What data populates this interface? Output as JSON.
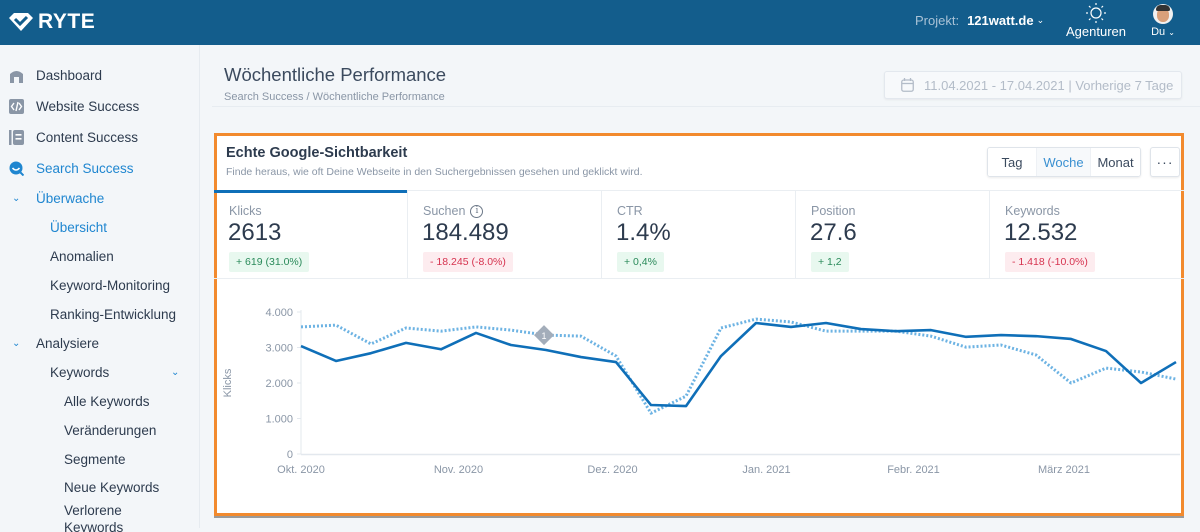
{
  "header": {
    "logo_text": "RYTE",
    "project_label": "Projekt:",
    "project_value": "121watt.de",
    "agencies_label": "Agenturen",
    "user_label": "Du"
  },
  "sidebar": {
    "items": [
      {
        "label": "Dashboard",
        "icon": "home-icon",
        "level": 0
      },
      {
        "label": "Website Success",
        "icon": "code-icon",
        "level": 0
      },
      {
        "label": "Content Success",
        "icon": "document-icon",
        "level": 0
      },
      {
        "label": "Search Success",
        "icon": "search-icon",
        "level": 0,
        "active": true
      },
      {
        "label": "Überwache",
        "level": 1,
        "expanded": true,
        "active": true
      },
      {
        "label": "Übersicht",
        "level": 2,
        "active": true
      },
      {
        "label": "Anomalien",
        "level": 2
      },
      {
        "label": "Keyword-Monitoring",
        "level": 2
      },
      {
        "label": "Ranking-Entwicklung",
        "level": 2
      },
      {
        "label": "Analysiere",
        "level": 1,
        "expanded": true
      },
      {
        "label": "Keywords",
        "level": 2,
        "expanded": true
      },
      {
        "label": "Alle Keywords",
        "level": 3
      },
      {
        "label": "Veränderungen",
        "level": 3
      },
      {
        "label": "Segmente",
        "level": 3
      },
      {
        "label": "Neue Keywords",
        "level": 3
      },
      {
        "label": "Verlorene Keywords",
        "level": 3
      }
    ]
  },
  "page": {
    "title": "Wöchentliche Performance",
    "breadcrumb": "Search Success / Wöchentliche Performance",
    "date_range": "11.04.2021 - 17.04.2021 | Vorherige 7 Tage"
  },
  "card": {
    "title": "Echte Google-Sichtbarkeit",
    "subtitle": "Finde heraus, wie oft Deine Webseite in den Suchergebnissen gesehen und geklickt wird.",
    "granularity": [
      "Tag",
      "Woche",
      "Monat"
    ],
    "granularity_selected": "Woche",
    "more_label": "···",
    "metrics": [
      {
        "label": "Klicks",
        "value": "2613",
        "delta": "+ 619 (31.0%)",
        "trend": "positive",
        "active": true
      },
      {
        "label": "Suchen",
        "value": "184.489",
        "delta": "- 18.245 (-8.0%)",
        "trend": "negative",
        "info": true
      },
      {
        "label": "CTR",
        "value": "1.4%",
        "delta": "+ 0,4%",
        "trend": "positive"
      },
      {
        "label": "Position",
        "value": "27.6",
        "delta": "+ 1,2",
        "trend": "positive"
      },
      {
        "label": "Keywords",
        "value": "12.532",
        "delta": "- 1.418 (-10.0%)",
        "trend": "negative"
      }
    ]
  },
  "colors": {
    "brand": "#135d8c",
    "accent": "#1f86d0",
    "series_current": "#0f6fb8",
    "series_previous": "#6db3e3",
    "annotation": "#a3adba"
  },
  "chart_data": {
    "type": "line",
    "title": "",
    "xlabel": "",
    "ylabel": "Klicks",
    "ylim": [
      0,
      4000
    ],
    "yticks": [
      0,
      1000,
      2000,
      3000,
      4000
    ],
    "ytick_labels": [
      "0",
      "1.000",
      "2.000",
      "3.000",
      "4.000"
    ],
    "x_month_labels": [
      {
        "label": "Okt. 2020",
        "index": 0
      },
      {
        "label": "Nov. 2020",
        "index": 4.5
      },
      {
        "label": "Dez. 2020",
        "index": 8.9
      },
      {
        "label": "Jan. 2021",
        "index": 13.3
      },
      {
        "label": "Febr. 2021",
        "index": 17.5
      },
      {
        "label": "März 2021",
        "index": 21.8
      }
    ],
    "grid": false,
    "legend": "none",
    "annotations": [
      {
        "label": "1",
        "index": 7,
        "series": "previous"
      }
    ],
    "series": [
      {
        "name": "current",
        "style": "solid",
        "values": [
          3040,
          2620,
          2840,
          3130,
          2950,
          3410,
          3070,
          2930,
          2730,
          2590,
          1380,
          1350,
          2760,
          3690,
          3580,
          3690,
          3520,
          3460,
          3490,
          3300,
          3350,
          3320,
          3240,
          2900,
          2000,
          2590
        ]
      },
      {
        "name": "previous",
        "style": "dotted",
        "values": [
          3580,
          3630,
          3100,
          3550,
          3460,
          3580,
          3490,
          3350,
          3320,
          2760,
          1150,
          1630,
          3550,
          3800,
          3720,
          3460,
          3460,
          3460,
          3320,
          3010,
          3070,
          2790,
          2000,
          2420,
          2310,
          2110
        ]
      }
    ]
  }
}
